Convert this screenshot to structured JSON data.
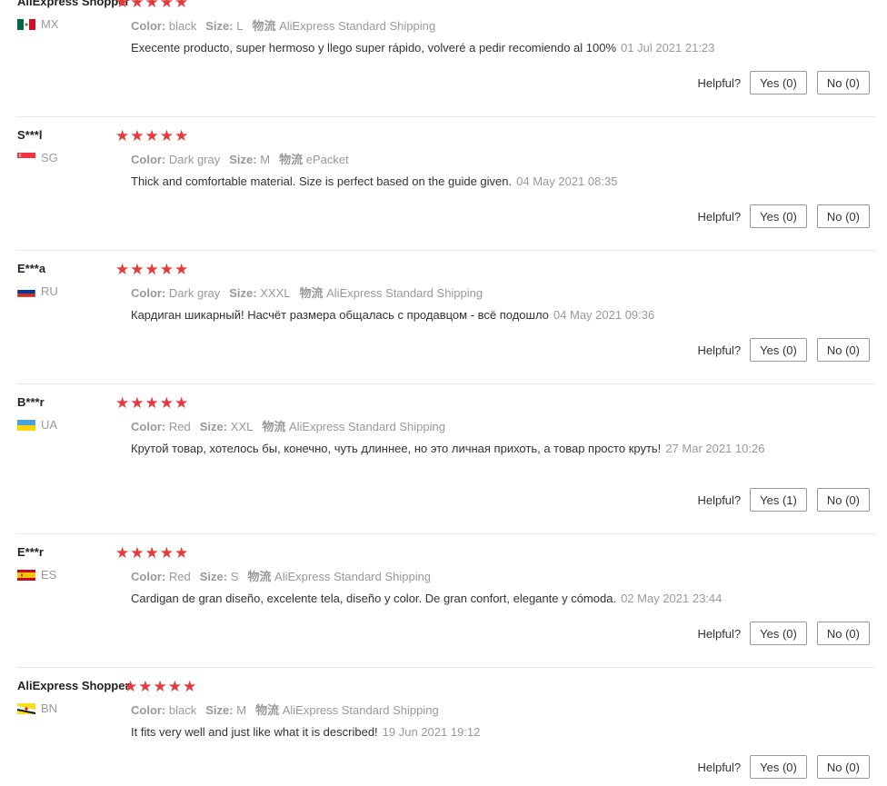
{
  "labels": {
    "color": "Color:",
    "size": "Size:",
    "logistics": "物流",
    "helpful": "Helpful?"
  },
  "reviews": [
    {
      "user": "AliExpress Shopper",
      "country": "MX",
      "flag": "mx-flag-icon",
      "rating": 5,
      "color": "black",
      "size": "L",
      "logistics": "AliExpress Standard Shipping",
      "text": "Execente producto, super hermoso y llego super rápido, volveré a pedir recomiendo al 100%",
      "date": "01 Jul 2021 21:23",
      "yes": "Yes (0)",
      "no": "No (0)"
    },
    {
      "user": "S***l",
      "country": "SG",
      "flag": "sg-flag-icon",
      "rating": 5,
      "color": "Dark gray",
      "size": "M",
      "logistics": "ePacket",
      "text": "Thick and comfortable material. Size is perfect based on the guide given.",
      "date": "04 May 2021 08:35",
      "yes": "Yes (0)",
      "no": "No (0)"
    },
    {
      "user": "E***a",
      "country": "RU",
      "flag": "ru-flag-icon",
      "rating": 5,
      "color": "Dark gray",
      "size": "XXXL",
      "logistics": "AliExpress Standard Shipping",
      "text": "Кардиган шикарный! Насчёт размера общалась с продавцом - всё подошло",
      "date": "04 May 2021 09:36",
      "yes": "Yes (0)",
      "no": "No (0)"
    },
    {
      "user": "B***r",
      "country": "UA",
      "flag": "ua-flag-icon",
      "rating": 5,
      "color": "Red",
      "size": "XXL",
      "logistics": "AliExpress Standard Shipping",
      "text": "Крутой товар, хотелось бы, конечно, чуть длиннее, но это личная прихоть, а товар просто круть!",
      "date": "27 Mar 2021 10:26",
      "yes": "Yes (1)",
      "no": "No (0)"
    },
    {
      "user": "E***r",
      "country": "ES",
      "flag": "es-flag-icon",
      "rating": 5,
      "color": "Red",
      "size": "S",
      "logistics": "AliExpress Standard Shipping",
      "text": "Cardigan de gran diseño, excelente tela, diseño y color. De gran confort, elegante y cómoda.",
      "date": "02 May 2021 23:44",
      "yes": "Yes (0)",
      "no": "No (0)"
    },
    {
      "user": "AliExpress Shopper",
      "country": "BN",
      "flag": "bn-flag-icon",
      "rating": 5,
      "color": "black",
      "size": "M",
      "logistics": "AliExpress Standard Shipping",
      "text": "It fits very well and just like what it is described!",
      "date": "19 Jun 2021 19:12",
      "yes": "Yes (0)",
      "no": "No (0)"
    }
  ]
}
